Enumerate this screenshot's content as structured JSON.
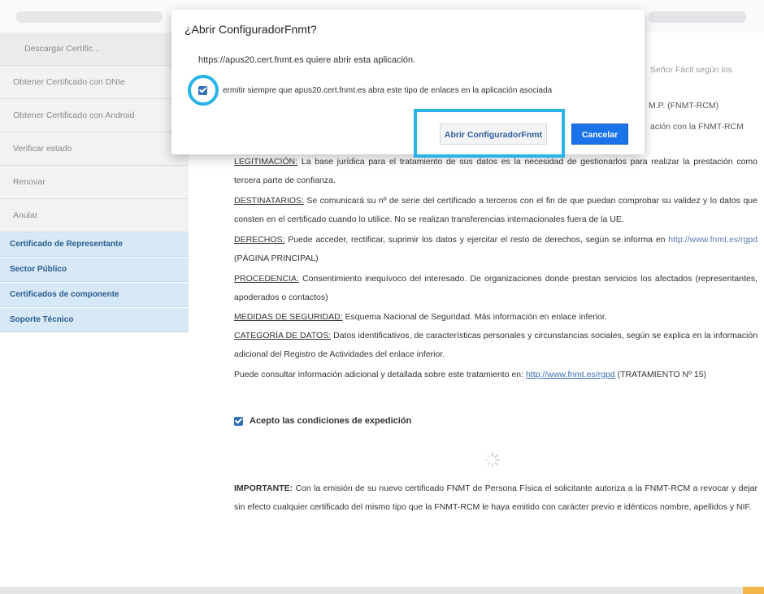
{
  "sidebar": {
    "items": [
      {
        "label": "Descargar Certific..."
      },
      {
        "label": "Obtener Certificado con DNIe"
      },
      {
        "label": "Obtener Certificado con Android"
      },
      {
        "label": "Verificar estado"
      },
      {
        "label": "Renovar"
      },
      {
        "label": "Anular"
      }
    ],
    "sections": [
      {
        "label": "Certificado de Representante"
      },
      {
        "label": "Sector Público"
      },
      {
        "label": "Certificados de componente"
      },
      {
        "label": "Soporte Técnico"
      }
    ]
  },
  "main": {
    "frag_top_right": "Señor Fácil según los",
    "frag_fnmt": "M.P. (FNMT-RCM)",
    "frag_relacion": "ación con la FNMT-RCM",
    "legitimacion_label": "LEGITIMACIÓN:",
    "legitimacion_text": "La base jurídica para el tratamiento de sus datos es la necesidad de gestionarlos para realizar la prestación como tercera parte de confianza.",
    "destinatarios_label": "DESTINATARIOS:",
    "destinatarios_text": "Se comunicará su nº de serie del certificado a terceros con el fin de que puedan comprobar su validez y lo datos que consten en el certificado cuando lo utilice. No se realizan transferencias internacionales fuera de la UE.",
    "derechos_label": "DERECHOS:",
    "derechos_text": "Puede acceder, rectificar, suprimir los datos y ejercitar el resto de derechos, según se informa en",
    "derechos_link": "http://www.fnmt.es/rgpd",
    "derechos_tail": "(PÁGINA PRINCIPAL)",
    "procedencia_label": "PROCEDENCIA:",
    "procedencia_text": "Consentimiento inequívoco del interesado. De organizaciones donde prestan servicios los afectados (representantes, apoderados o contactos)",
    "medidas_label": "MEDIDAS DE SEGURIDAD:",
    "medidas_text": "Esquema Nacional de Seguridad. Más información en enlace inferior.",
    "categoria_label": "CATEGORÍA DE DATOS:",
    "categoria_text": "Datos identificativos, de características personales y circunstancias sociales, según se explica en la información adicional del Registro de Actividades del enlace inferior.",
    "consultar_text": "Puede consultar información adicional y detallada sobre este tratamiento en:",
    "consultar_link": "http://www.fnmt.es/rgpd",
    "consultar_tail": "(TRATAMIENTO Nº 15)",
    "accept_label": "Acepto las condiciones de expedición",
    "important_label": "IMPORTANTE:",
    "important_text": "Con la emisión de su nuevo certificado FNMT de Persona Física el solicitante autoriza a la FNMT-RCM a revocar y dejar sin efecto cualquier certificado del mismo tipo que la FNMT-RCM le haya emitido con carácter previo e idénticos nombre, apellidos y NIF."
  },
  "dialog": {
    "title": "¿Abrir ConfiguradorFnmt?",
    "message": "https://apus20.cert.fnmt.es quiere abrir esta aplicación.",
    "checkbox_label": "ermitir siempre que apus20.cert.fnmt.es abra este tipo de enlaces en la aplicación asociada",
    "open_button": "Abrir ConfiguradorFnmt",
    "cancel_button": "Cancelar",
    "checkbox_checked": true
  },
  "colors": {
    "accent": "#1a73e8",
    "highlight": "#2ab3e6",
    "sidebar_section_bg": "#d7e8f6",
    "sidebar_section_text": "#2a5d8f"
  }
}
